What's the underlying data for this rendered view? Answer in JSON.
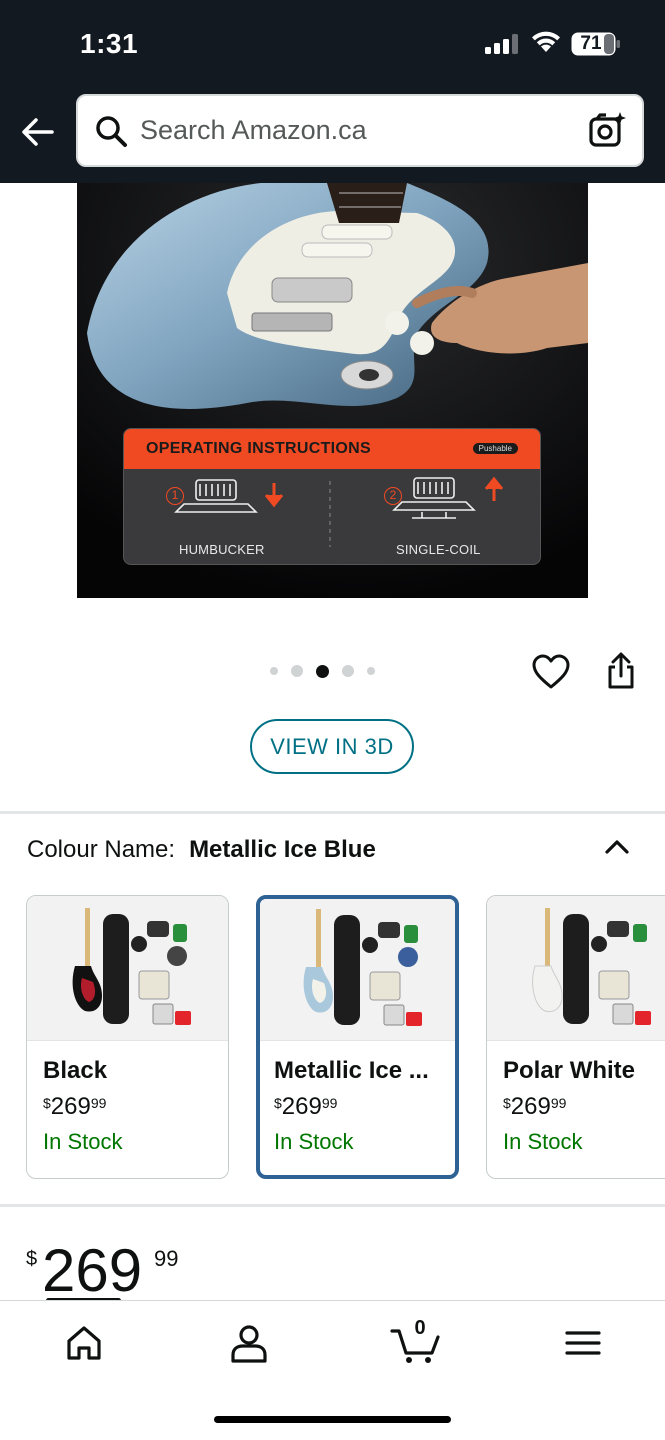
{
  "status_bar": {
    "time": "1:31",
    "battery": "71"
  },
  "header": {
    "back_icon": "arrow-left-icon",
    "search_placeholder": "Search Amazon.ca",
    "search_icon": "search-icon",
    "camera_icon": "camera-sparkle-icon"
  },
  "product_image": {
    "panel_title": "OPERATING INSTRUCTIONS",
    "panel_tag": "Pushable",
    "step1_number": "1",
    "step1_label": "HUMBUCKER",
    "step2_number": "2",
    "step2_label": "SINGLE-COIL"
  },
  "gallery": {
    "image_count": 5,
    "active_index": 2,
    "wishlist_icon": "heart-icon",
    "share_icon": "share-icon",
    "view_3d_label": "VIEW IN 3D"
  },
  "colour": {
    "label": "Colour Name:",
    "selected": "Metallic Ice Blue",
    "collapse_icon": "chevron-up-icon",
    "options": [
      {
        "name": "Black",
        "currency": "$",
        "whole": "269",
        "fraction": "99",
        "stock": "In Stock",
        "body_color": "#111111"
      },
      {
        "name": "Metallic Ice ...",
        "currency": "$",
        "whole": "269",
        "fraction": "99",
        "stock": "In Stock",
        "body_color": "#a9c8dc"
      },
      {
        "name": "Polar White",
        "currency": "$",
        "whole": "269",
        "fraction": "99",
        "stock": "In Stock",
        "body_color": "#f2f2f0"
      }
    ]
  },
  "price": {
    "currency": "$",
    "whole": "269",
    "fraction": "99"
  },
  "bottom_nav": {
    "items": [
      "home-icon",
      "account-icon",
      "cart-icon",
      "menu-icon"
    ],
    "cart_count": "0"
  },
  "colors": {
    "header_bg": "#131921",
    "link": "#007185",
    "in_stock": "#007600",
    "selected_border": "#2e6294",
    "instructions_accent": "#f04a23"
  }
}
